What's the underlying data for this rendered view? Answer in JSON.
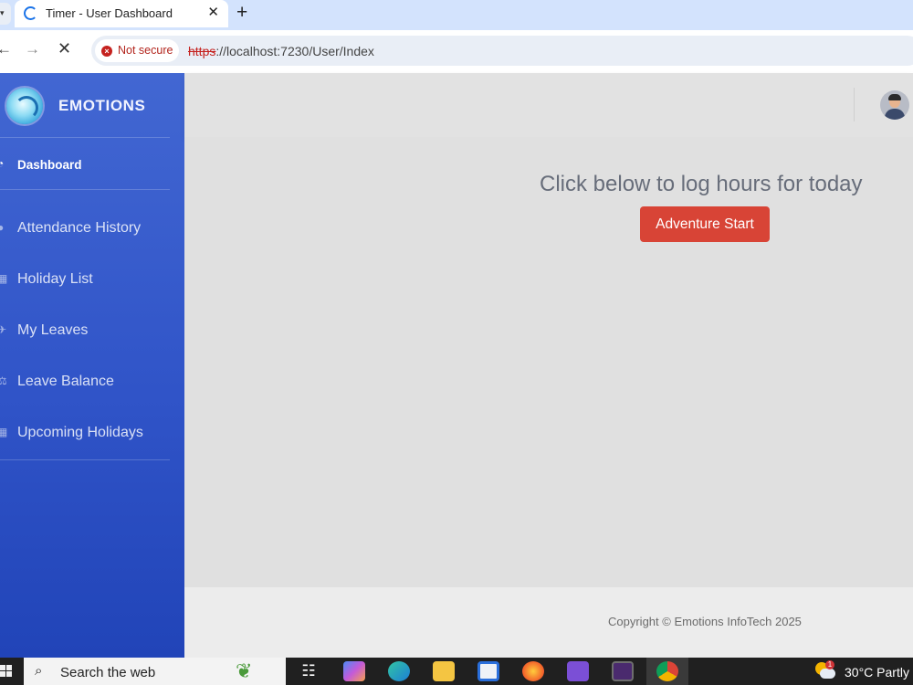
{
  "browser": {
    "tab_title": "Timer - User Dashboard",
    "tab_close": "✕",
    "new_tab": "+",
    "security_chip": "Not secure",
    "url_scheme": "https",
    "url_rest": "://localhost:7230/User/Index"
  },
  "sidebar": {
    "brand": "EMOTIONS",
    "items": [
      {
        "label": "Dashboard",
        "icon": "gauge-icon",
        "active": true
      },
      {
        "label": "Attendance History",
        "icon": "users-icon"
      },
      {
        "label": "Holiday List",
        "icon": "calendar-icon"
      },
      {
        "label": "My Leaves",
        "icon": "plane-icon"
      },
      {
        "label": "Leave Balance",
        "icon": "scale-icon"
      },
      {
        "label": "Upcoming Holidays",
        "icon": "calendar-icon"
      }
    ]
  },
  "main": {
    "prompt": "Click below to log hours for today",
    "start_button": "Adventure Start"
  },
  "footer": {
    "copyright": "Copyright © Emotions InfoTech 2025"
  },
  "taskbar": {
    "search_placeholder": "Search the web",
    "weather_temp": "30°C",
    "weather_desc": "Partly",
    "weather_badge": "1"
  },
  "colors": {
    "sidebar_top": "#4267d2",
    "sidebar_bottom": "#2144b8",
    "start_button": "#d84436",
    "not_secure": "#c5221f"
  }
}
